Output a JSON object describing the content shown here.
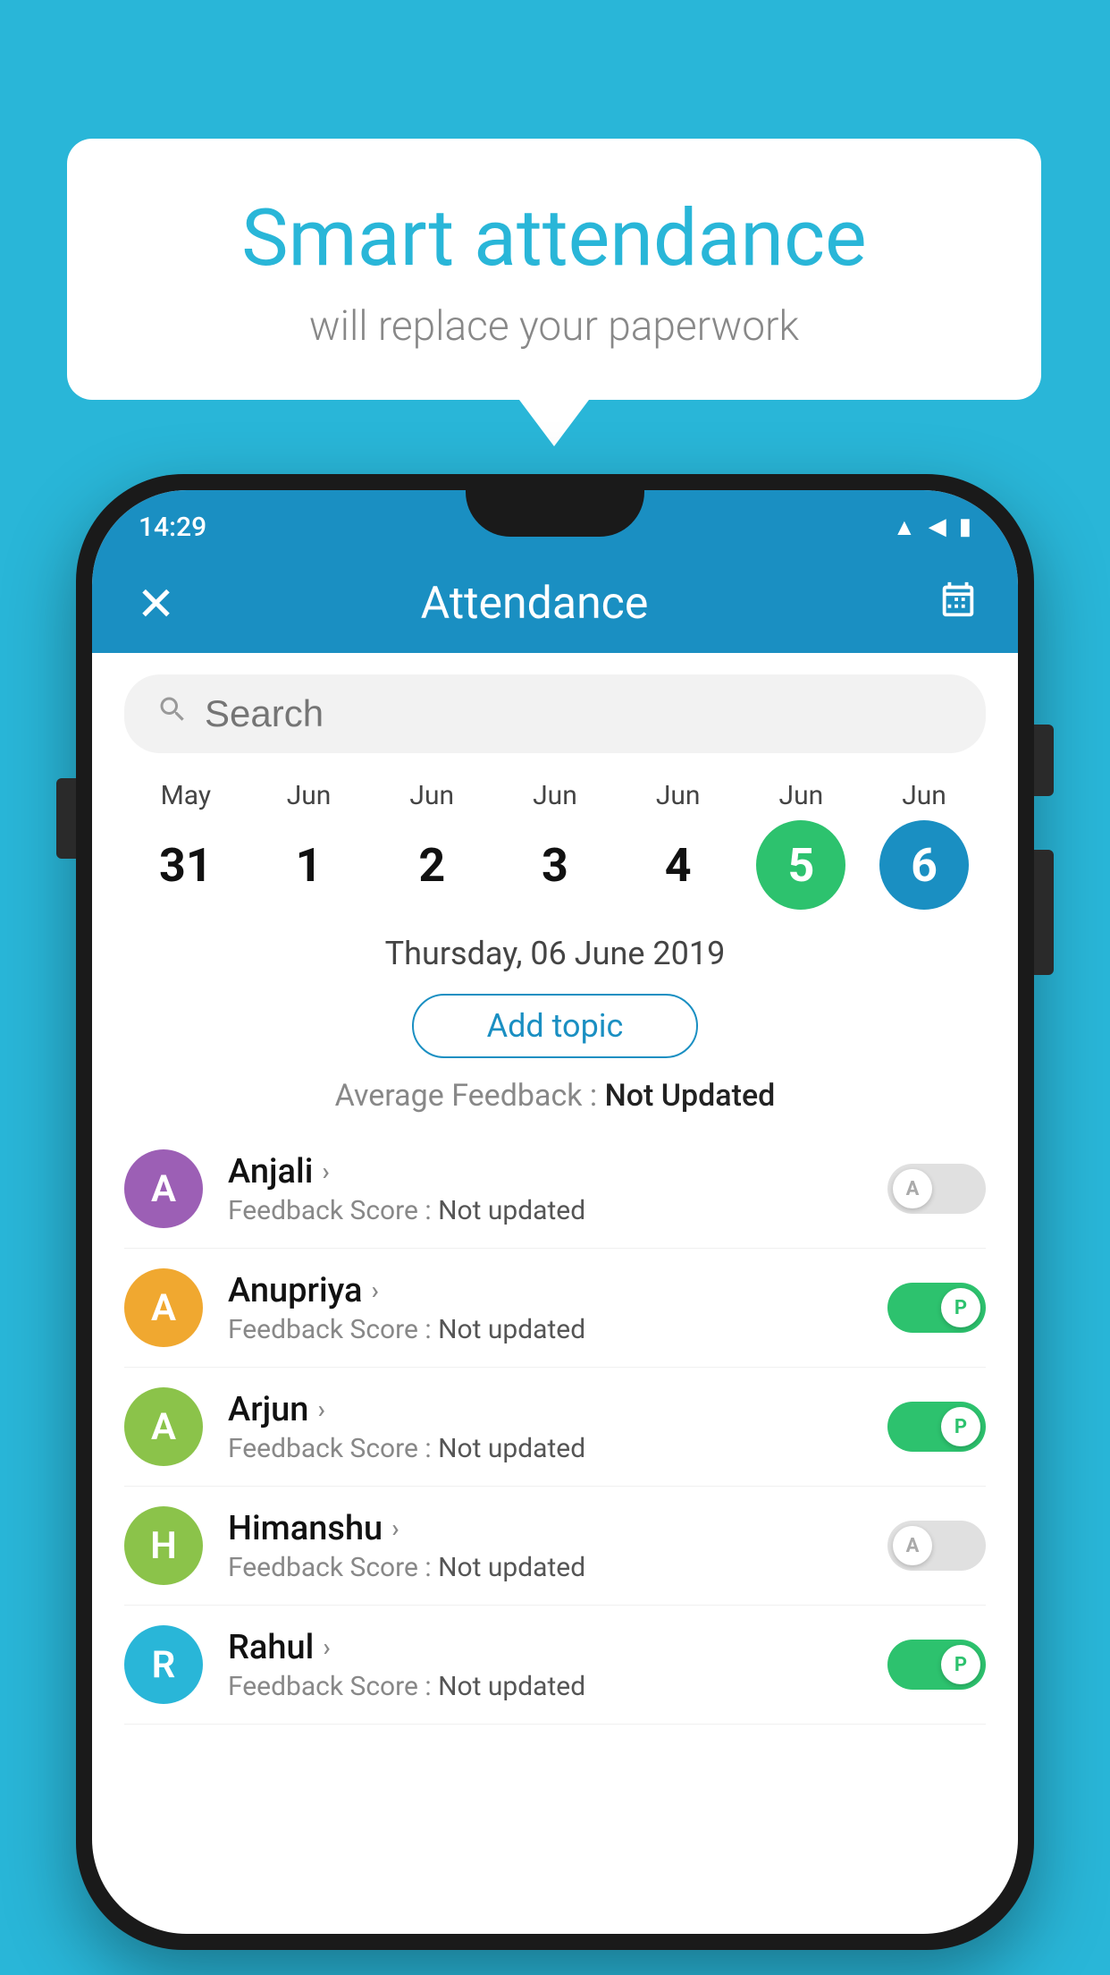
{
  "background_color": "#29b6d8",
  "speech_bubble": {
    "title": "Smart attendance",
    "subtitle": "will replace your paperwork"
  },
  "status_bar": {
    "time": "14:29",
    "wifi": "▲",
    "signal": "◀",
    "battery": "▮"
  },
  "app_header": {
    "title": "Attendance",
    "close_label": "✕",
    "calendar_icon": "📅"
  },
  "search": {
    "placeholder": "Search"
  },
  "calendar": {
    "days": [
      {
        "month": "May",
        "number": "31",
        "state": "normal"
      },
      {
        "month": "Jun",
        "number": "1",
        "state": "normal"
      },
      {
        "month": "Jun",
        "number": "2",
        "state": "normal"
      },
      {
        "month": "Jun",
        "number": "3",
        "state": "normal"
      },
      {
        "month": "Jun",
        "number": "4",
        "state": "normal"
      },
      {
        "month": "Jun",
        "number": "5",
        "state": "today"
      },
      {
        "month": "Jun",
        "number": "6",
        "state": "selected"
      }
    ],
    "selected_date": "Thursday, 06 June 2019"
  },
  "add_topic": {
    "label": "Add topic"
  },
  "avg_feedback": {
    "label": "Average Feedback : ",
    "value": "Not Updated"
  },
  "students": [
    {
      "name": "Anjali",
      "avatar_letter": "A",
      "avatar_color": "#9c5fb5",
      "feedback_label": "Feedback Score : ",
      "feedback_value": "Not updated",
      "toggle_state": "off",
      "toggle_label": "A"
    },
    {
      "name": "Anupriya",
      "avatar_letter": "A",
      "avatar_color": "#f0a830",
      "feedback_label": "Feedback Score : ",
      "feedback_value": "Not updated",
      "toggle_state": "on",
      "toggle_label": "P"
    },
    {
      "name": "Arjun",
      "avatar_letter": "A",
      "avatar_color": "#8bc34a",
      "feedback_label": "Feedback Score : ",
      "feedback_value": "Not updated",
      "toggle_state": "on",
      "toggle_label": "P"
    },
    {
      "name": "Himanshu",
      "avatar_letter": "H",
      "avatar_color": "#8bc34a",
      "feedback_label": "Feedback Score : ",
      "feedback_value": "Not updated",
      "toggle_state": "off",
      "toggle_label": "A"
    },
    {
      "name": "Rahul",
      "avatar_letter": "R",
      "avatar_color": "#29b6d8",
      "feedback_label": "Feedback Score : ",
      "feedback_value": "Not updated",
      "toggle_state": "on",
      "toggle_label": "P"
    }
  ]
}
